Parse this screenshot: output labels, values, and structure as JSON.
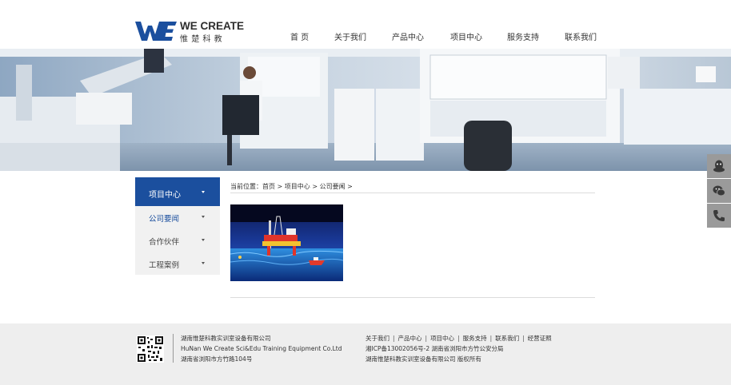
{
  "brand": {
    "logo_en": "WE CREATE",
    "logo_cn": "惟楚科教",
    "color": "#1b4f9e"
  },
  "nav": {
    "items": [
      {
        "label": "首 页"
      },
      {
        "label": "关于我们"
      },
      {
        "label": "产品中心"
      },
      {
        "label": "项目中心"
      },
      {
        "label": "服务支持"
      },
      {
        "label": "联系我们"
      }
    ]
  },
  "sidebar": {
    "heading": "项目中心",
    "items": [
      {
        "label": "公司要闻",
        "active": true
      },
      {
        "label": "合作伙伴"
      },
      {
        "label": "工程案例"
      }
    ],
    "accent": "#1b4f9e"
  },
  "breadcrumb": {
    "prefix": "当前位置：",
    "items": [
      "首页",
      "项目中心",
      "公司要闻"
    ],
    "separator": ">"
  },
  "float_buttons": [
    {
      "icon": "qq-icon"
    },
    {
      "icon": "wechat-icon"
    },
    {
      "icon": "phone-icon"
    }
  ],
  "footer": {
    "company_cn": "湖南惟楚科教实训室设备有限公司",
    "company_en": "HuNan We Create Sci&Edu Training Equipment Co.Ltd",
    "address": "湖南省浏阳市方竹路104号",
    "links": [
      "关于我们",
      "产品中心",
      "项目中心",
      "服务支持",
      "联系我们",
      "经营证照"
    ],
    "icp": "湘ICP备13002056号-2 湖南省浏阳市方竹公安分局",
    "copyright": "湖南惟楚科教实训室设备有限公司 版权所有"
  }
}
